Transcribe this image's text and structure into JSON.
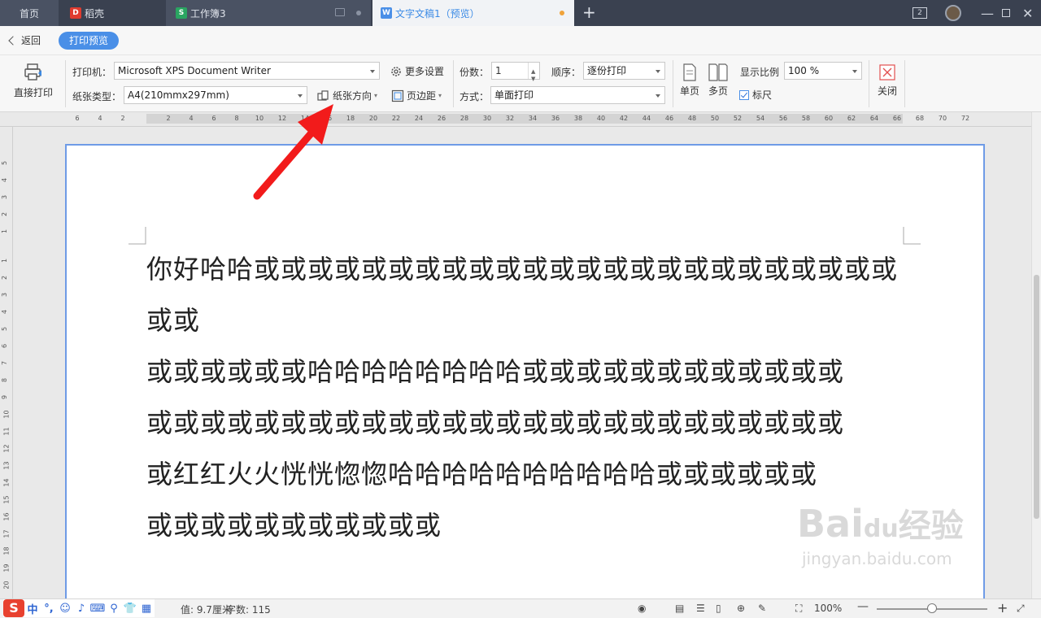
{
  "tabs": {
    "home": "首页",
    "dk": "稻壳",
    "wb": "工作簿3",
    "doc": "文字文稿1（预览）",
    "badge": "2"
  },
  "sub": {
    "back": "返回",
    "preview": "打印预览"
  },
  "toolbar": {
    "direct_print": "直接打印",
    "printer_label": "打印机：",
    "printer_value": "Microsoft XPS Document Writer",
    "more_settings": "更多设置",
    "paper_label": "纸张类型：",
    "paper_value": "A4(210mmx297mm)",
    "orientation": "纸张方向",
    "margins": "页边距",
    "copies_label": "份数：",
    "copies_value": "1",
    "order_label": "顺序：",
    "order_value": "逐份打印",
    "mode_label": "方式：",
    "mode_value": "单面打印",
    "single": "单页",
    "multi": "多页",
    "zoom_label": "显示比例",
    "zoom_value": "100 %",
    "ruler": "标尺",
    "close": "关闭"
  },
  "ruler_ticks": [
    "6",
    "4",
    "2",
    "2",
    "4",
    "6",
    "8",
    "10",
    "12",
    "14",
    "16",
    "18",
    "20",
    "22",
    "24",
    "26",
    "28",
    "30",
    "32",
    "34",
    "36",
    "38",
    "40",
    "42",
    "44",
    "46",
    "48",
    "50",
    "52",
    "54",
    "56",
    "58",
    "60",
    "62",
    "64",
    "66",
    "68",
    "70",
    "72"
  ],
  "vruler_ticks": [
    "5",
    "4",
    "3",
    "2",
    "1",
    "1",
    "2",
    "3",
    "4",
    "5",
    "6",
    "7",
    "8",
    "9",
    "10",
    "11",
    "12",
    "13",
    "14",
    "15",
    "16",
    "17",
    "18",
    "19",
    "20"
  ],
  "document": {
    "lines": [
      "你好哈哈或或或或或或或或或或或或或或或或或或或或或或或或或或",
      "或或或或或或哈哈哈哈哈哈哈哈或或或或或或或或或或或或",
      "或或或或或或或或或或或或或或或或或或或或或或或或或或",
      "或红红火火恍恍惚惚哈哈哈哈哈哈哈哈哈哈或或或或或或",
      "或或或或或或或或或或或"
    ]
  },
  "status": {
    "pos": "值: 9.7厘米",
    "words": "字数: 115",
    "zoom": "100%"
  },
  "ime": [
    "中",
    "°,",
    "☺",
    "♪",
    "⌨",
    "⚲",
    "👕",
    "▦"
  ],
  "watermark": {
    "brand": "Bai",
    "du": "du",
    "jy": "经验",
    "url": "jingyan.baidu.com"
  },
  "colors": {
    "accent": "#4a8fe7",
    "arrow": "#f21b1b"
  }
}
